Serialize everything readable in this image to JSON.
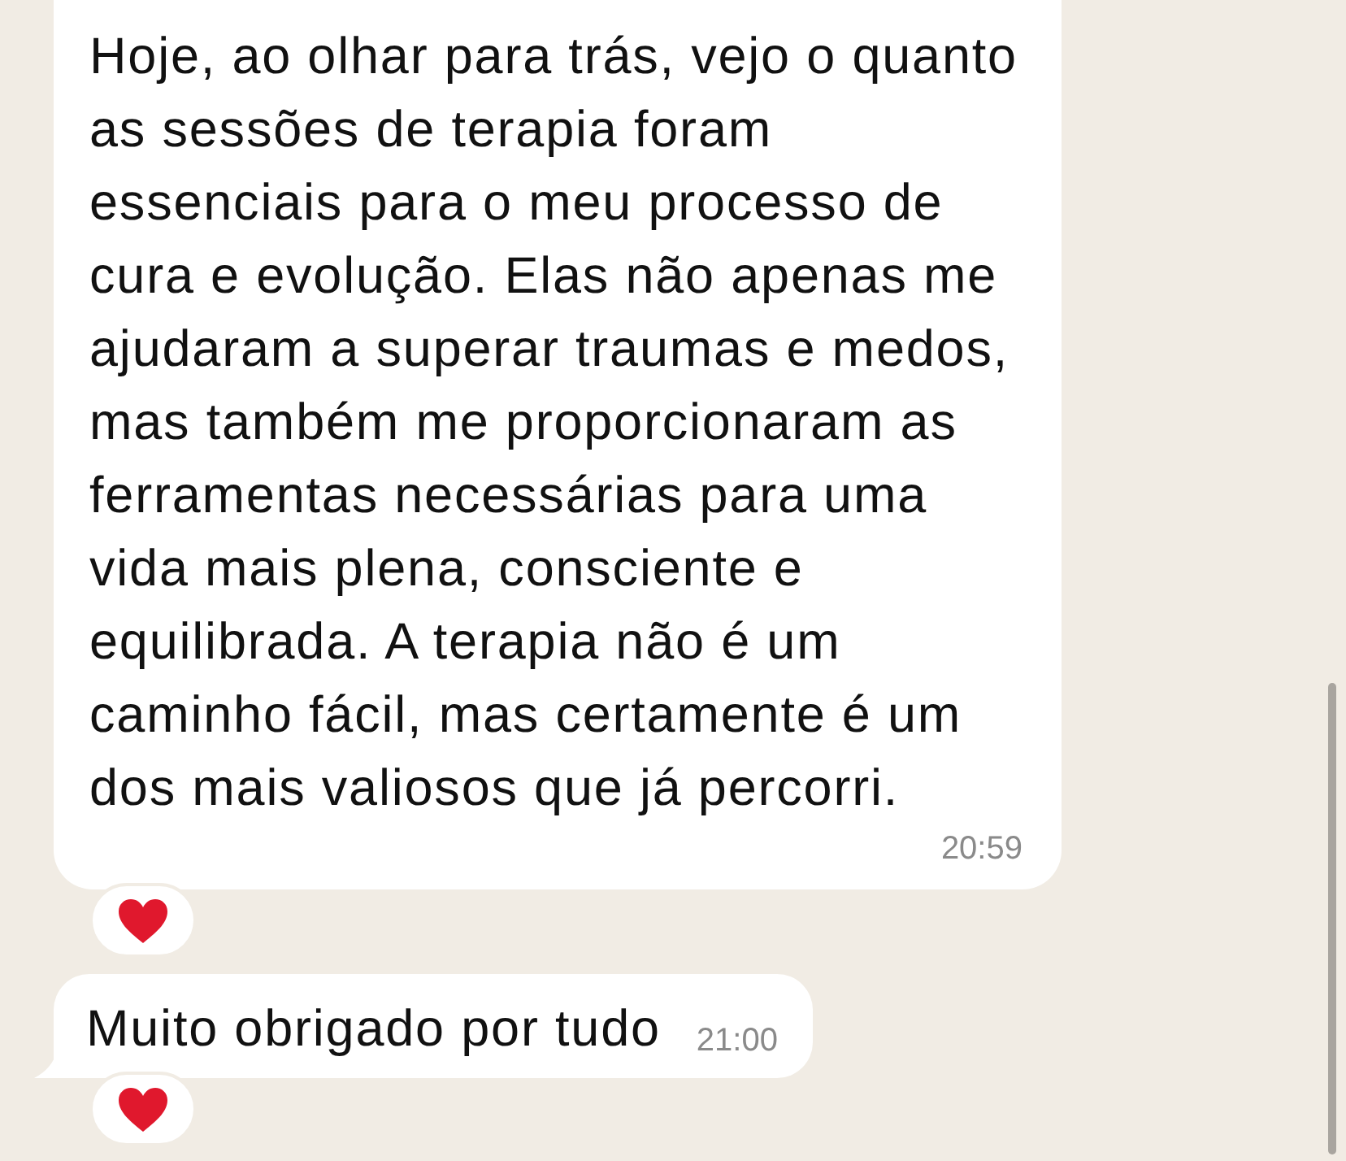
{
  "messages": [
    {
      "text": "Hoje, ao olhar para trás, vejo o quanto as sessões de terapia foram essenciais para o meu processo de cura e evolução. Elas não apenas me ajudaram a superar traumas e medos, mas também me proporcionaram as ferramentas necessárias para uma vida mais plena, consciente e equilibrada. A terapia não é um caminho fácil, mas certamente é um dos mais valiosos que já percorri.",
      "time": "20:59",
      "reacted": true,
      "tail": false
    },
    {
      "text": "Muito obrigado por tudo",
      "time": "21:00",
      "reacted": true,
      "tail": true
    }
  ]
}
